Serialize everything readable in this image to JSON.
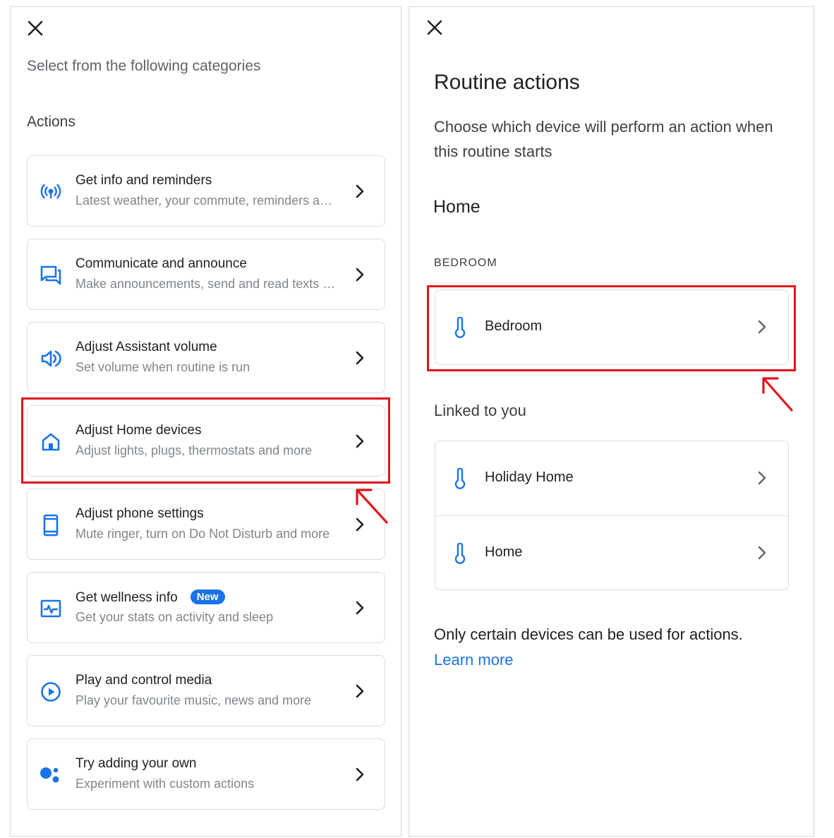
{
  "left": {
    "subtitle": "Select from the following categories",
    "section_label": "Actions",
    "actions": [
      {
        "title": "Get info and reminders",
        "description": "Latest weather, your commute, reminders and more",
        "icon": "broadcast-icon"
      },
      {
        "title": "Communicate and announce",
        "description": "Make announcements, send and read texts and more",
        "icon": "chat-icon"
      },
      {
        "title": "Adjust Assistant volume",
        "description": "Set volume when routine is run",
        "icon": "volume-icon"
      },
      {
        "title": "Adjust Home devices",
        "description": "Adjust lights, plugs, thermostats and more",
        "icon": "home-icon"
      },
      {
        "title": "Adjust phone settings",
        "description": "Mute ringer, turn on Do Not Disturb and more",
        "icon": "phone-icon"
      },
      {
        "title": "Get wellness info",
        "badge": "New",
        "description": "Get your stats on activity and sleep",
        "icon": "wellness-icon"
      },
      {
        "title": "Play and control media",
        "description": "Play your favourite music, news and more",
        "icon": "play-icon"
      },
      {
        "title": "Try adding your own",
        "description": "Experiment with custom actions",
        "icon": "assistant-dots-icon"
      }
    ]
  },
  "right": {
    "title": "Routine actions",
    "description": "Choose which device will perform an action when this routine starts",
    "home_heading": "Home",
    "room_label": "BEDROOM",
    "room_devices": [
      {
        "name": "Bedroom",
        "icon": "thermometer-icon"
      }
    ],
    "linked_label": "Linked to you",
    "linked_devices": [
      {
        "name": "Holiday Home",
        "icon": "thermometer-icon"
      },
      {
        "name": "Home",
        "icon": "thermometer-icon"
      }
    ],
    "note": "Only certain devices can be used for actions.",
    "learn_more": "Learn more"
  },
  "colors": {
    "accent": "#1a73e8",
    "highlight": "#e0141b",
    "secondary_text": "#80868b",
    "border": "#dadce0"
  }
}
